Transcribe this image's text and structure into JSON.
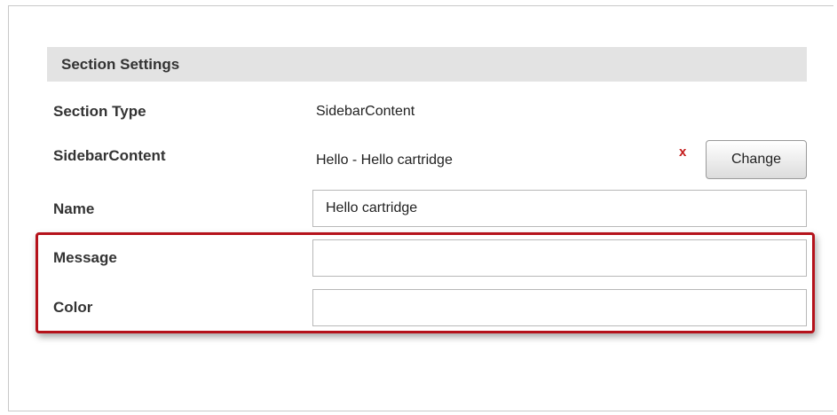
{
  "section": {
    "title": "Section Settings"
  },
  "rows": {
    "section_type": {
      "label": "Section Type",
      "value": "SidebarContent"
    },
    "sidebar_content": {
      "label": "SidebarContent",
      "value": "Hello - Hello cartridge",
      "remove_label": "x",
      "change_label": "Change"
    },
    "name": {
      "label": "Name",
      "value": "Hello cartridge"
    },
    "message": {
      "label": "Message",
      "value": ""
    },
    "color": {
      "label": "Color",
      "value": ""
    }
  },
  "colors": {
    "highlight_border": "#b5121b",
    "remove_x": "#c41a1a",
    "header_background": "#e3e3e3"
  }
}
